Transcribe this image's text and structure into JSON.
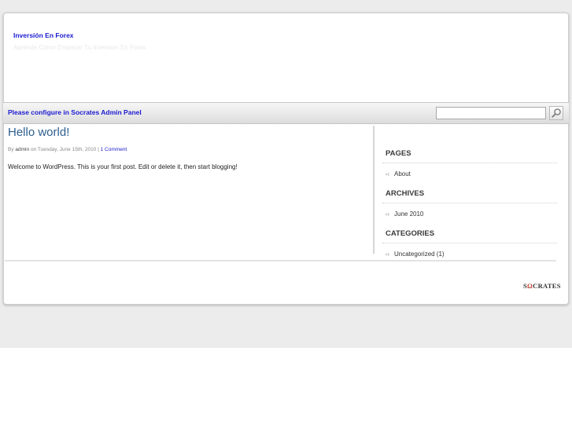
{
  "header": {
    "site_title": "Inversión En Forex",
    "tagline": "Aprende Como Empezar Tu Inversion En Forex"
  },
  "nav": {
    "link_label": "Please configure in Socrates Admin Panel"
  },
  "search": {
    "placeholder": ""
  },
  "post": {
    "title": "Hello world!",
    "meta_prefix": "By",
    "author": "admin",
    "meta_date": "on Tuesday, June 15th, 2010",
    "meta_sep": "|",
    "comments": "1 Comment",
    "body": "Welcome to WordPress. This is your first post. Edit or delete it, then start blogging!"
  },
  "sidebar": {
    "pages_title": "PAGES",
    "pages": [
      "About"
    ],
    "archives_title": "ARCHIVES",
    "archives": [
      "June 2010"
    ],
    "categories_title": "CATEGORIES",
    "categories": [
      "Uncategorized (1)"
    ]
  },
  "footer": {
    "brand_prefix": "S",
    "brand_omega": "Ω",
    "brand_suffix": "CRATES"
  },
  "icons": {
    "search": "search-icon",
    "bullet": "arrow-bullet-icon"
  },
  "colors": {
    "link": "#1a1ad0",
    "post_title": "#2e5f8f",
    "brand_accent": "#c0392b"
  }
}
